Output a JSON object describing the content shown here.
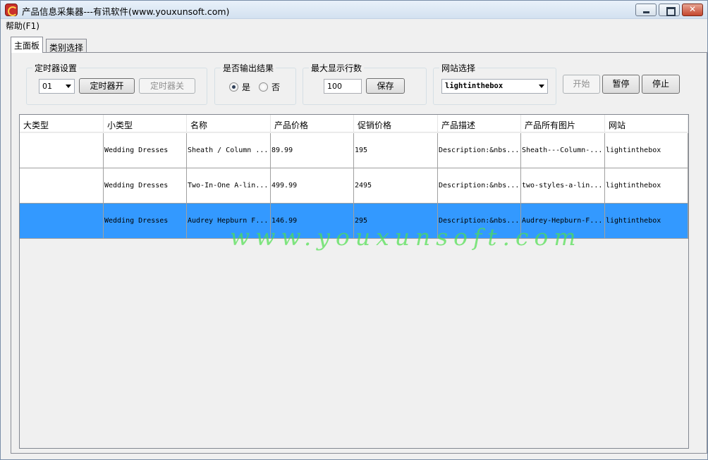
{
  "window": {
    "title": "产品信息采集器---有讯软件(www.youxunsoft.com)"
  },
  "menu": {
    "help": "帮助(F1)"
  },
  "tabs": [
    {
      "label": "主面板"
    },
    {
      "label": "类别选择"
    }
  ],
  "timer": {
    "group_title": "定时器设置",
    "interval_value": "01",
    "on_label": "定时器开",
    "off_label": "定时器关"
  },
  "output": {
    "group_title": "是否输出结果",
    "yes_label": "是",
    "no_label": "否",
    "selected": "是"
  },
  "max_rows": {
    "group_title": "最大显示行数",
    "value": "100",
    "save_label": "保存"
  },
  "site": {
    "group_title": "网站选择",
    "selected": "lightinthebox"
  },
  "actions": {
    "start": "开始",
    "pause": "暂停",
    "stop": "停止"
  },
  "table": {
    "columns": [
      "大类型",
      "小类型",
      "名称",
      "产品价格",
      "促销价格",
      "产品描述",
      "产品所有图片",
      "网站"
    ],
    "rows": [
      [
        "",
        "Wedding Dresses",
        "Sheath / Column ...",
        "89.99",
        "195",
        "Description:&nbs...",
        "Sheath---Column-...",
        "lightinthebox"
      ],
      [
        "",
        "Wedding Dresses",
        "Two-In-One A-lin...",
        "499.99",
        "2495",
        "Description:&nbs...",
        "two-styles-a-lin...",
        "lightinthebox"
      ],
      [
        "",
        "Wedding Dresses",
        "Audrey Hepburn F...",
        "146.99",
        "295",
        "Description:&nbs...",
        "Audrey-Hepburn-F...",
        "lightinthebox"
      ]
    ],
    "selected_row": 2
  },
  "watermark": "www.youxunsoft.com",
  "colors": {
    "selection": "#3399ff",
    "watermark": "#4fe04f",
    "titlebar": "#dbe7f4"
  }
}
